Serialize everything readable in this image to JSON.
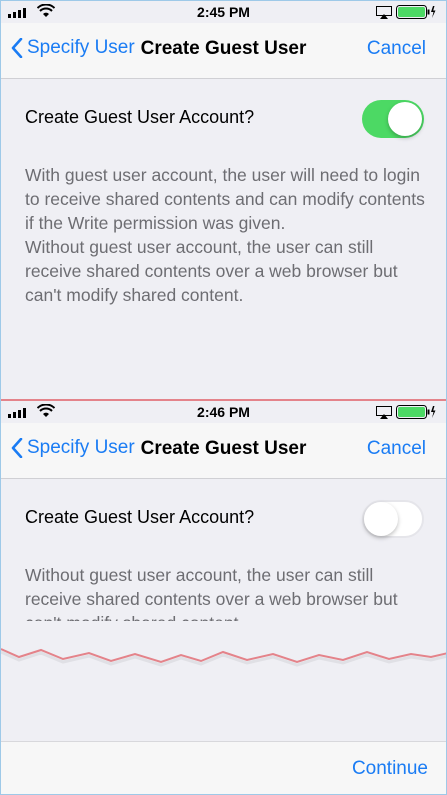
{
  "screen_top": {
    "status": {
      "time": "2:45 PM"
    },
    "nav": {
      "back_label": "Specify User",
      "title": "Create Guest User",
      "cancel_label": "Cancel"
    },
    "setting": {
      "label": "Create Guest User Account?",
      "toggle_on": true
    },
    "description": [
      "With guest user account, the user will need to login to receive shared contents and can modify contents if the Write permission was given.",
      "Without guest user account, the user can still receive shared contents over a web browser but can't modify shared content."
    ]
  },
  "screen_overlay": {
    "status": {
      "time": "2:46 PM"
    },
    "nav": {
      "back_label": "Specify User",
      "title": "Create Guest User",
      "cancel_label": "Cancel"
    },
    "setting": {
      "label": "Create Guest User Account?",
      "toggle_on": false
    },
    "description": [
      "Without guest user account, the user can still receive shared contents over a web browser but can't modify shared content."
    ]
  },
  "footer": {
    "continue_label": "Continue"
  },
  "colors": {
    "accent": "#1a7cf4",
    "toggle_on": "#4cd964",
    "battery": "#4cd964",
    "overlay_border": "#e4838a"
  }
}
